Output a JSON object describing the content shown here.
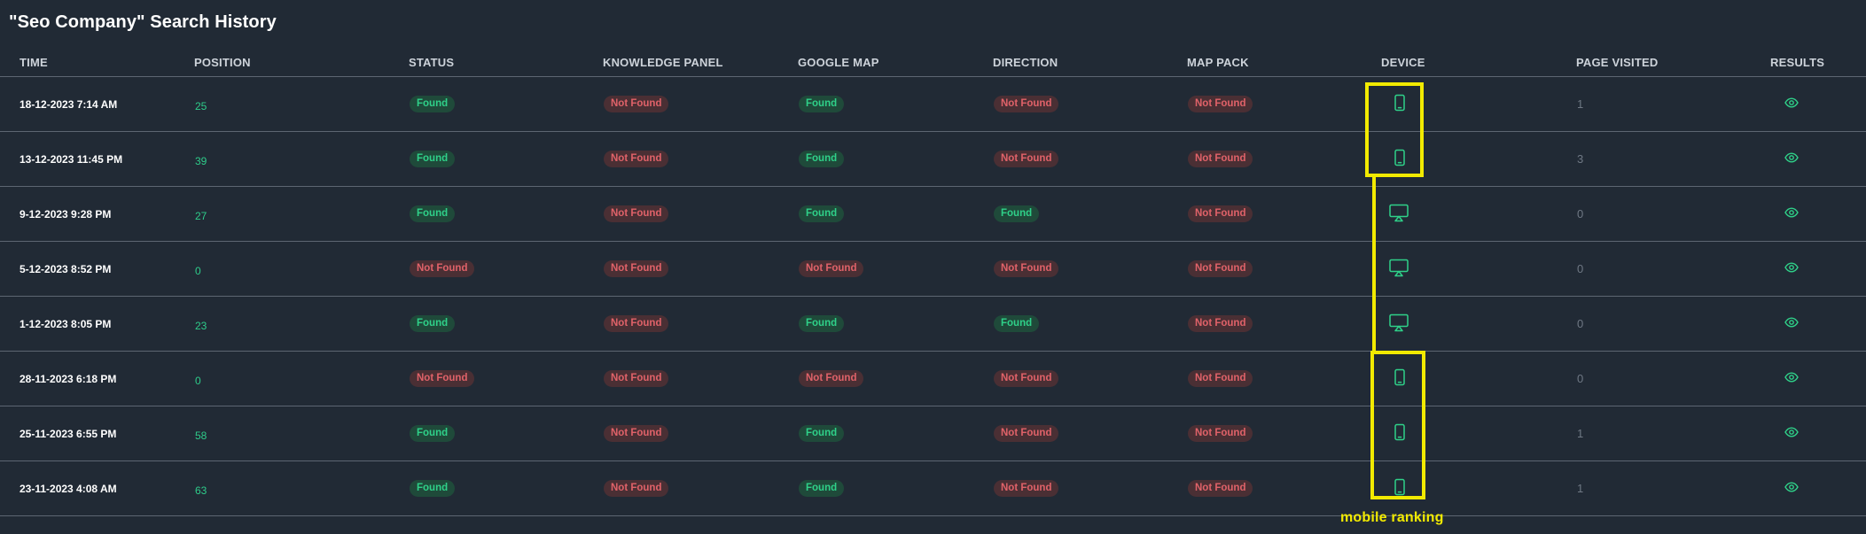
{
  "page": {
    "title": "\"Seo Company\" Search History"
  },
  "table": {
    "headers": {
      "time": "TIME",
      "position": "POSITION",
      "status": "STATUS",
      "knowledge_panel": "KNOWLEDGE PANEL",
      "google_map": "GOOGLE MAP",
      "direction": "DIRECTION",
      "map_pack": "MAP PACK",
      "device": "DEVICE",
      "page_visited": "PAGE VISITED",
      "results": "RESULTS"
    },
    "rows": [
      {
        "time": "18-12-2023 7:14 AM",
        "position": "25",
        "status": "Found",
        "knowledge_panel": "Not Found",
        "google_map": "Found",
        "direction": "Not Found",
        "map_pack": "Not Found",
        "device": "mobile-icon",
        "page_visited": "1",
        "results": "eye-icon"
      },
      {
        "time": "13-12-2023 11:45 PM",
        "position": "39",
        "status": "Found",
        "knowledge_panel": "Not Found",
        "google_map": "Found",
        "direction": "Not Found",
        "map_pack": "Not Found",
        "device": "mobile-icon",
        "page_visited": "3",
        "results": "eye-icon"
      },
      {
        "time": "9-12-2023 9:28 PM",
        "position": "27",
        "status": "Found",
        "knowledge_panel": "Not Found",
        "google_map": "Found",
        "direction": "Found",
        "map_pack": "Not Found",
        "device": "desktop-icon",
        "page_visited": "0",
        "results": "eye-icon"
      },
      {
        "time": "5-12-2023 8:52 PM",
        "position": "0",
        "status": "Not Found",
        "knowledge_panel": "Not Found",
        "google_map": "Not Found",
        "direction": "Not Found",
        "map_pack": "Not Found",
        "device": "desktop-icon",
        "page_visited": "0",
        "results": "eye-icon"
      },
      {
        "time": "1-12-2023 8:05 PM",
        "position": "23",
        "status": "Found",
        "knowledge_panel": "Not Found",
        "google_map": "Found",
        "direction": "Found",
        "map_pack": "Not Found",
        "device": "desktop-icon",
        "page_visited": "0",
        "results": "eye-icon"
      },
      {
        "time": "28-11-2023 6:18 PM",
        "position": "0",
        "status": "Not Found",
        "knowledge_panel": "Not Found",
        "google_map": "Not Found",
        "direction": "Not Found",
        "map_pack": "Not Found",
        "device": "mobile-icon",
        "page_visited": "0",
        "results": "eye-icon"
      },
      {
        "time": "25-11-2023 6:55 PM",
        "position": "58",
        "status": "Found",
        "knowledge_panel": "Not Found",
        "google_map": "Found",
        "direction": "Not Found",
        "map_pack": "Not Found",
        "device": "mobile-icon",
        "page_visited": "1",
        "results": "eye-icon"
      },
      {
        "time": "23-11-2023 4:08 AM",
        "position": "63",
        "status": "Found",
        "knowledge_panel": "Not Found",
        "google_map": "Found",
        "direction": "Not Found",
        "map_pack": "Not Found",
        "device": "mobile-icon",
        "page_visited": "1",
        "results": "eye-icon"
      }
    ]
  },
  "annotation": {
    "label": "mobile ranking"
  },
  "colors": {
    "background": "#212a35",
    "found_text": "#2fd189",
    "found_bg": "#1f4a3a",
    "notfound_text": "#e06269",
    "notfound_bg": "#4a2f34",
    "highlight": "#f2ea00",
    "icon": "#2fd189"
  }
}
